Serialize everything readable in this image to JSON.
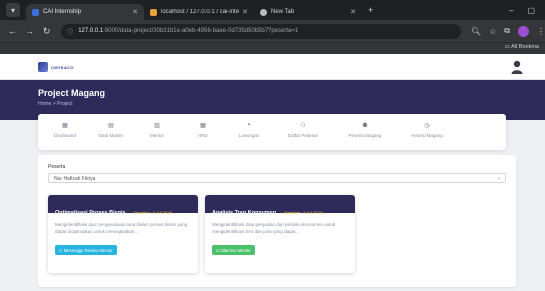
{
  "browser": {
    "tabs": [
      {
        "title": "CAI Internship",
        "active": true,
        "fav_color": "#3b6fe0"
      },
      {
        "title": "localhost / 127.0.0.1 / cai-intern",
        "active": false,
        "fav_color": "#e8a23a"
      },
      {
        "title": "New Tab",
        "active": false,
        "fav_color": "#bbbbbb"
      }
    ],
    "url_host": "127.0.0.1",
    "url_path": ":8000/data-project/30b31b1e-a0eb-4956-baee-0d735d50b5b7?peserta=1",
    "bookmarks_label": "All Bookma"
  },
  "app": {
    "logo_text": "CMYK&CO"
  },
  "hero": {
    "title": "Project Magang",
    "breadcrumb": "Home  >  Project"
  },
  "nav": [
    {
      "label": "Dashboard",
      "icon": "dashboard-icon",
      "glyph": "▦"
    },
    {
      "label": "Data Master",
      "icon": "database-icon",
      "glyph": "▤"
    },
    {
      "label": "Mentor",
      "icon": "mentor-icon",
      "glyph": "▥"
    },
    {
      "label": "HRD",
      "icon": "hrd-icon",
      "glyph": "▦"
    },
    {
      "label": "Lowongan",
      "icon": "briefcase-icon",
      "glyph": "▪"
    },
    {
      "label": "Daftar Pelamar",
      "icon": "applicants-icon",
      "glyph": "⚇"
    },
    {
      "label": "Peserta Magang",
      "icon": "participants-icon",
      "glyph": "⚉"
    },
    {
      "label": "History Magang",
      "icon": "history-icon",
      "glyph": "◷"
    }
  ],
  "filter": {
    "label": "Peserta",
    "selected": "Nur Hafizah Fitriya"
  },
  "projects": [
    {
      "title": "Optimalisasi Proses Bisnis",
      "deadline": "(Deadline : 3 Juli 2024)",
      "desc": "Mengidentifikasi dan mengevaluasi area dalam proses bisnis yang dapat dioptimalkan untuk meningkatkan...",
      "button": "Menunggu Review Mentor",
      "status": "waiting"
    },
    {
      "title": "Analisis Tren Konsumen",
      "deadline": "(Deadline : 3 Juli 2024)",
      "desc": "Mengidentifikasi data penjualan dan perilaku konsumen untuk mengidentifikasi tren dan pola yang dapat...",
      "button": "Diterima Mentor",
      "status": "accepted"
    }
  ],
  "colors": {
    "primary": "#2e2a5a",
    "wait": "#27b4e0",
    "done": "#4cbf6a",
    "deadline": "#f2c94c"
  }
}
